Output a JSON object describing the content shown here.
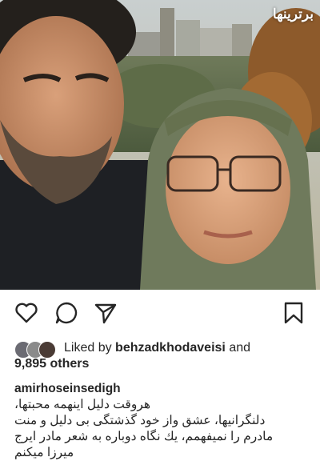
{
  "post": {
    "watermark": "برترینها",
    "liked_prefix": "Liked by",
    "liked_user": "behzadkhodaveisi",
    "liked_and": "and",
    "likes_count": "9,895 others",
    "caption_user": "amirhoseinsedigh",
    "caption_lines": [
      "هروقت دلیل اینهمه محبتها،",
      "دلنگرانیها، عشق واز خود گذشتگی بی دلیل و منت",
      "مادرم را نمیفهمم، یك نگاه دوباره به شعر مادر ایرج",
      "میرزا میکنم"
    ]
  },
  "icons": {
    "like": "heart-icon",
    "comment": "comment-bubble-icon",
    "share": "paper-plane-icon",
    "save": "bookmark-icon"
  }
}
